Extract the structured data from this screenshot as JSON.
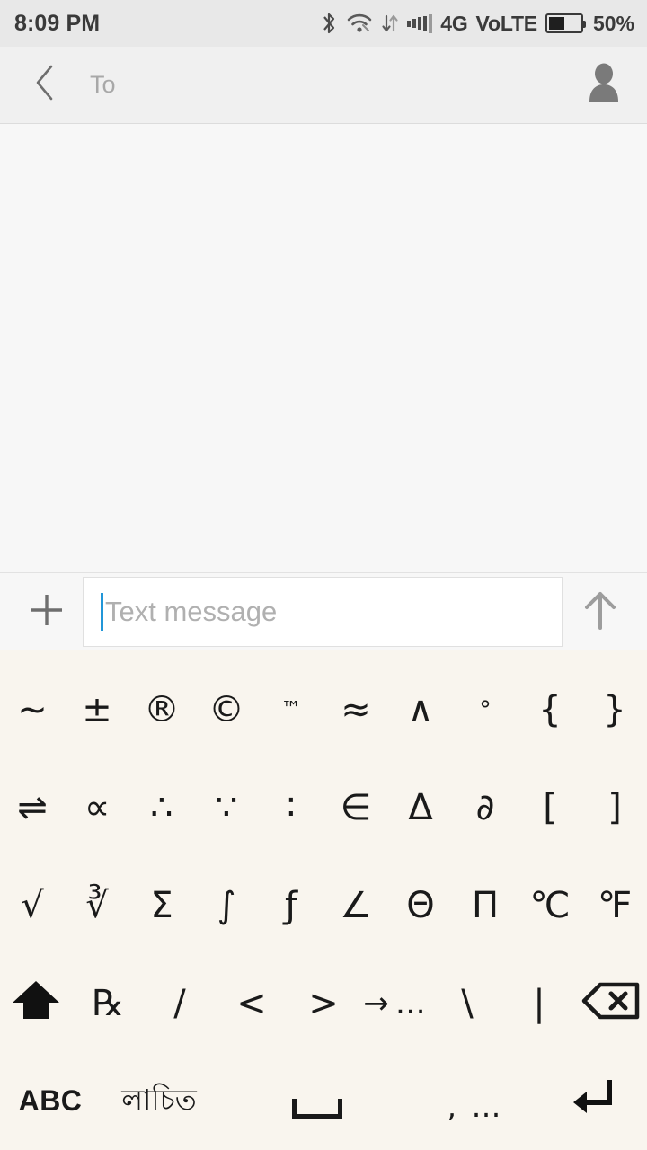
{
  "status_bar": {
    "clock": "8:09 PM",
    "bluetooth_icon": "bluetooth-icon",
    "wifi_icon": "wifi-icon",
    "data_transfer_icon": "data-transfer-icon",
    "signal_icon": "signal-bars-icon",
    "network_type": "4G",
    "volte_label": "VoLTE",
    "battery_icon": "battery-icon",
    "battery_percent": "50%",
    "battery_level": 50
  },
  "nav_bar": {
    "back_icon": "back-chevron-icon",
    "recipient_placeholder": "To",
    "contact_icon": "contact-person-icon"
  },
  "compose": {
    "attach_icon": "plus-icon",
    "message_placeholder": "Text message",
    "message_value": "",
    "send_icon": "send-arrow-up-icon",
    "caret_color": "#2196d8"
  },
  "keyboard": {
    "background": "#f9f5ee",
    "rows": [
      [
        {
          "name": "key-tilde",
          "glyph": "~",
          "size": "normal"
        },
        {
          "name": "key-plus-minus",
          "glyph": "±",
          "size": "normal"
        },
        {
          "name": "key-registered",
          "glyph": "®",
          "size": "normal"
        },
        {
          "name": "key-copyright",
          "glyph": "©",
          "size": "normal"
        },
        {
          "name": "key-trademark",
          "glyph": "™",
          "size": "tiny"
        },
        {
          "name": "key-almost-equal",
          "glyph": "≈",
          "size": "normal"
        },
        {
          "name": "key-logical-and",
          "glyph": "∧",
          "size": "normal"
        },
        {
          "name": "key-degree",
          "glyph": "°",
          "size": "small"
        },
        {
          "name": "key-brace-left",
          "glyph": "{",
          "size": "normal"
        },
        {
          "name": "key-brace-right",
          "glyph": "}",
          "size": "normal"
        }
      ],
      [
        {
          "name": "key-equilibrium",
          "glyph": "⇌",
          "size": "normal"
        },
        {
          "name": "key-proportional",
          "glyph": "∝",
          "size": "normal"
        },
        {
          "name": "key-therefore",
          "glyph": "∴",
          "size": "normal"
        },
        {
          "name": "key-because",
          "glyph": "∵",
          "size": "normal"
        },
        {
          "name": "key-ratio",
          "glyph": "∶",
          "size": "normal"
        },
        {
          "name": "key-element-of",
          "glyph": "∈",
          "size": "normal"
        },
        {
          "name": "key-delta",
          "glyph": "Δ",
          "size": "normal"
        },
        {
          "name": "key-partial",
          "glyph": "∂",
          "size": "normal"
        },
        {
          "name": "key-bracket-left",
          "glyph": "[",
          "size": "normal"
        },
        {
          "name": "key-bracket-right",
          "glyph": "]",
          "size": "normal"
        }
      ],
      [
        {
          "name": "key-square-root",
          "glyph": "√",
          "size": "normal"
        },
        {
          "name": "key-cube-root",
          "glyph": "∛",
          "size": "normal"
        },
        {
          "name": "key-sigma",
          "glyph": "Σ",
          "size": "normal"
        },
        {
          "name": "key-integral",
          "glyph": "∫",
          "size": "normal"
        },
        {
          "name": "key-function",
          "glyph": "ƒ",
          "size": "normal"
        },
        {
          "name": "key-angle",
          "glyph": "∠",
          "size": "normal"
        },
        {
          "name": "key-theta",
          "glyph": "Θ",
          "size": "normal"
        },
        {
          "name": "key-pi-capital",
          "glyph": "Π",
          "size": "normal"
        },
        {
          "name": "key-celsius",
          "glyph": "℃",
          "size": "normal"
        },
        {
          "name": "key-fahrenheit",
          "glyph": "℉",
          "size": "normal"
        }
      ],
      [
        {
          "name": "key-shift",
          "glyph": "⬆",
          "size": "normal"
        },
        {
          "name": "key-prescription",
          "glyph": "℞",
          "size": "normal"
        },
        {
          "name": "key-slash",
          "glyph": "/",
          "size": "normal"
        },
        {
          "name": "key-less-than",
          "glyph": "<",
          "size": "normal"
        },
        {
          "name": "key-greater-than",
          "glyph": ">",
          "size": "normal"
        },
        {
          "name": "key-arrow-more",
          "glyph": "→",
          "size": "normal",
          "suffix": "…"
        },
        {
          "name": "key-backslash",
          "glyph": "\\",
          "size": "normal"
        },
        {
          "name": "key-pipe",
          "glyph": "|",
          "size": "normal"
        },
        {
          "name": "key-backspace",
          "glyph": "⌫",
          "size": "normal"
        }
      ]
    ],
    "bottom_row": {
      "abc_label": "ABC",
      "language_label": "লাচিত",
      "space_label": "",
      "comma_label": ",",
      "comma_more": "…",
      "enter_glyph": "⏎"
    }
  }
}
